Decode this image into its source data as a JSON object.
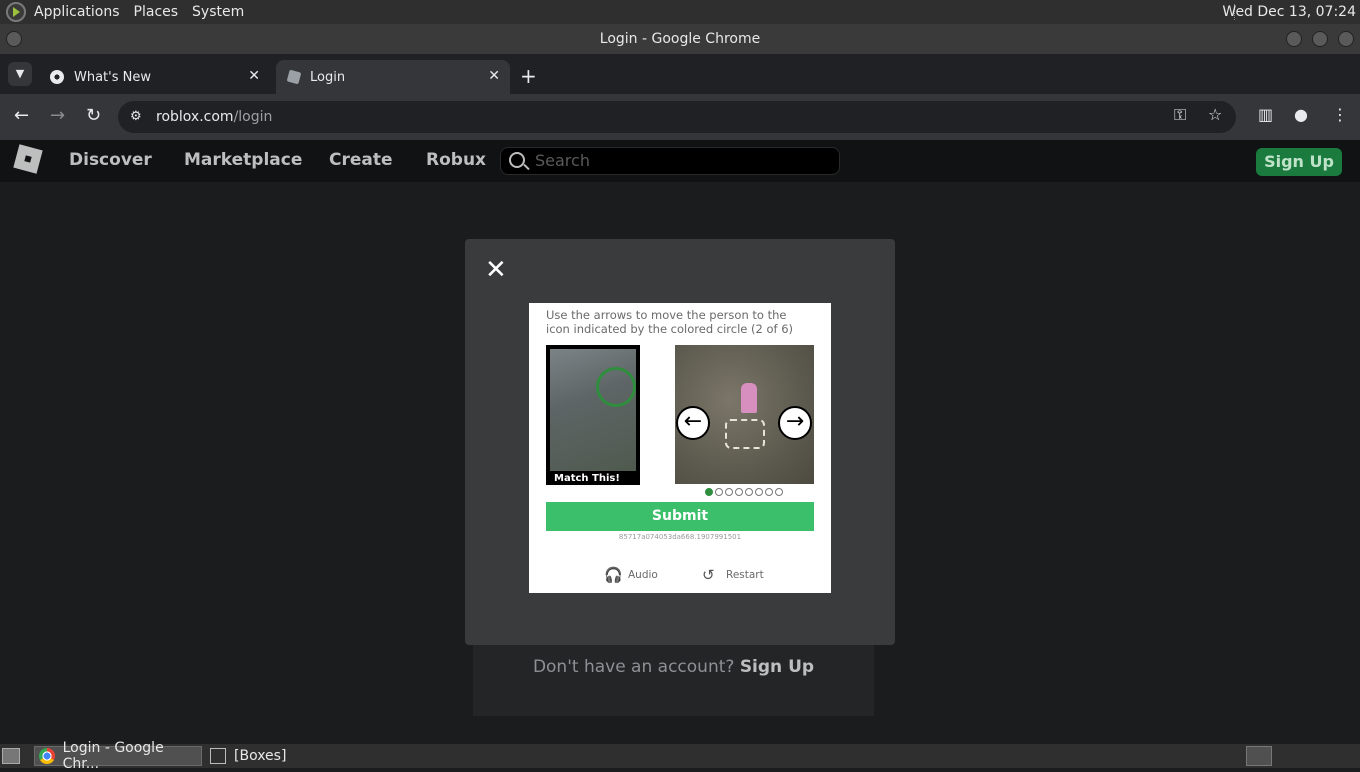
{
  "panel": {
    "menus": [
      "Applications",
      "Places",
      "System"
    ],
    "clock": "Wed Dec 13, 07:24"
  },
  "window": {
    "title": "Login - Google Chrome"
  },
  "tabs": [
    {
      "label": "What's New",
      "active": false
    },
    {
      "label": "Login",
      "active": true
    }
  ],
  "toolbar": {
    "url_host": "roblox.com",
    "url_path": "/login"
  },
  "roblox": {
    "nav": [
      "Discover",
      "Marketplace",
      "Create",
      "Robux"
    ],
    "search_placeholder": "Search",
    "signup_button": "Sign Up",
    "no_account": "Don't have an account?",
    "no_account_link": "Sign Up"
  },
  "captcha": {
    "instruction": "Use the arrows to move the person to the icon indicated by the colored circle (2 of 6)",
    "match_label": "Match This!",
    "left_arrow": "←",
    "right_arrow": "→",
    "selected_index": 1,
    "total_dots": 8,
    "submit": "Submit",
    "session_id": "85717a074053da668.1907991501",
    "audio": "Audio",
    "restart": "Restart"
  },
  "taskbar": {
    "items": [
      {
        "label": "Login - Google Chr...",
        "icon": "chrome-icon",
        "active": true
      },
      {
        "label": "[Boxes]",
        "icon": "boxes-icon",
        "active": false
      }
    ]
  }
}
